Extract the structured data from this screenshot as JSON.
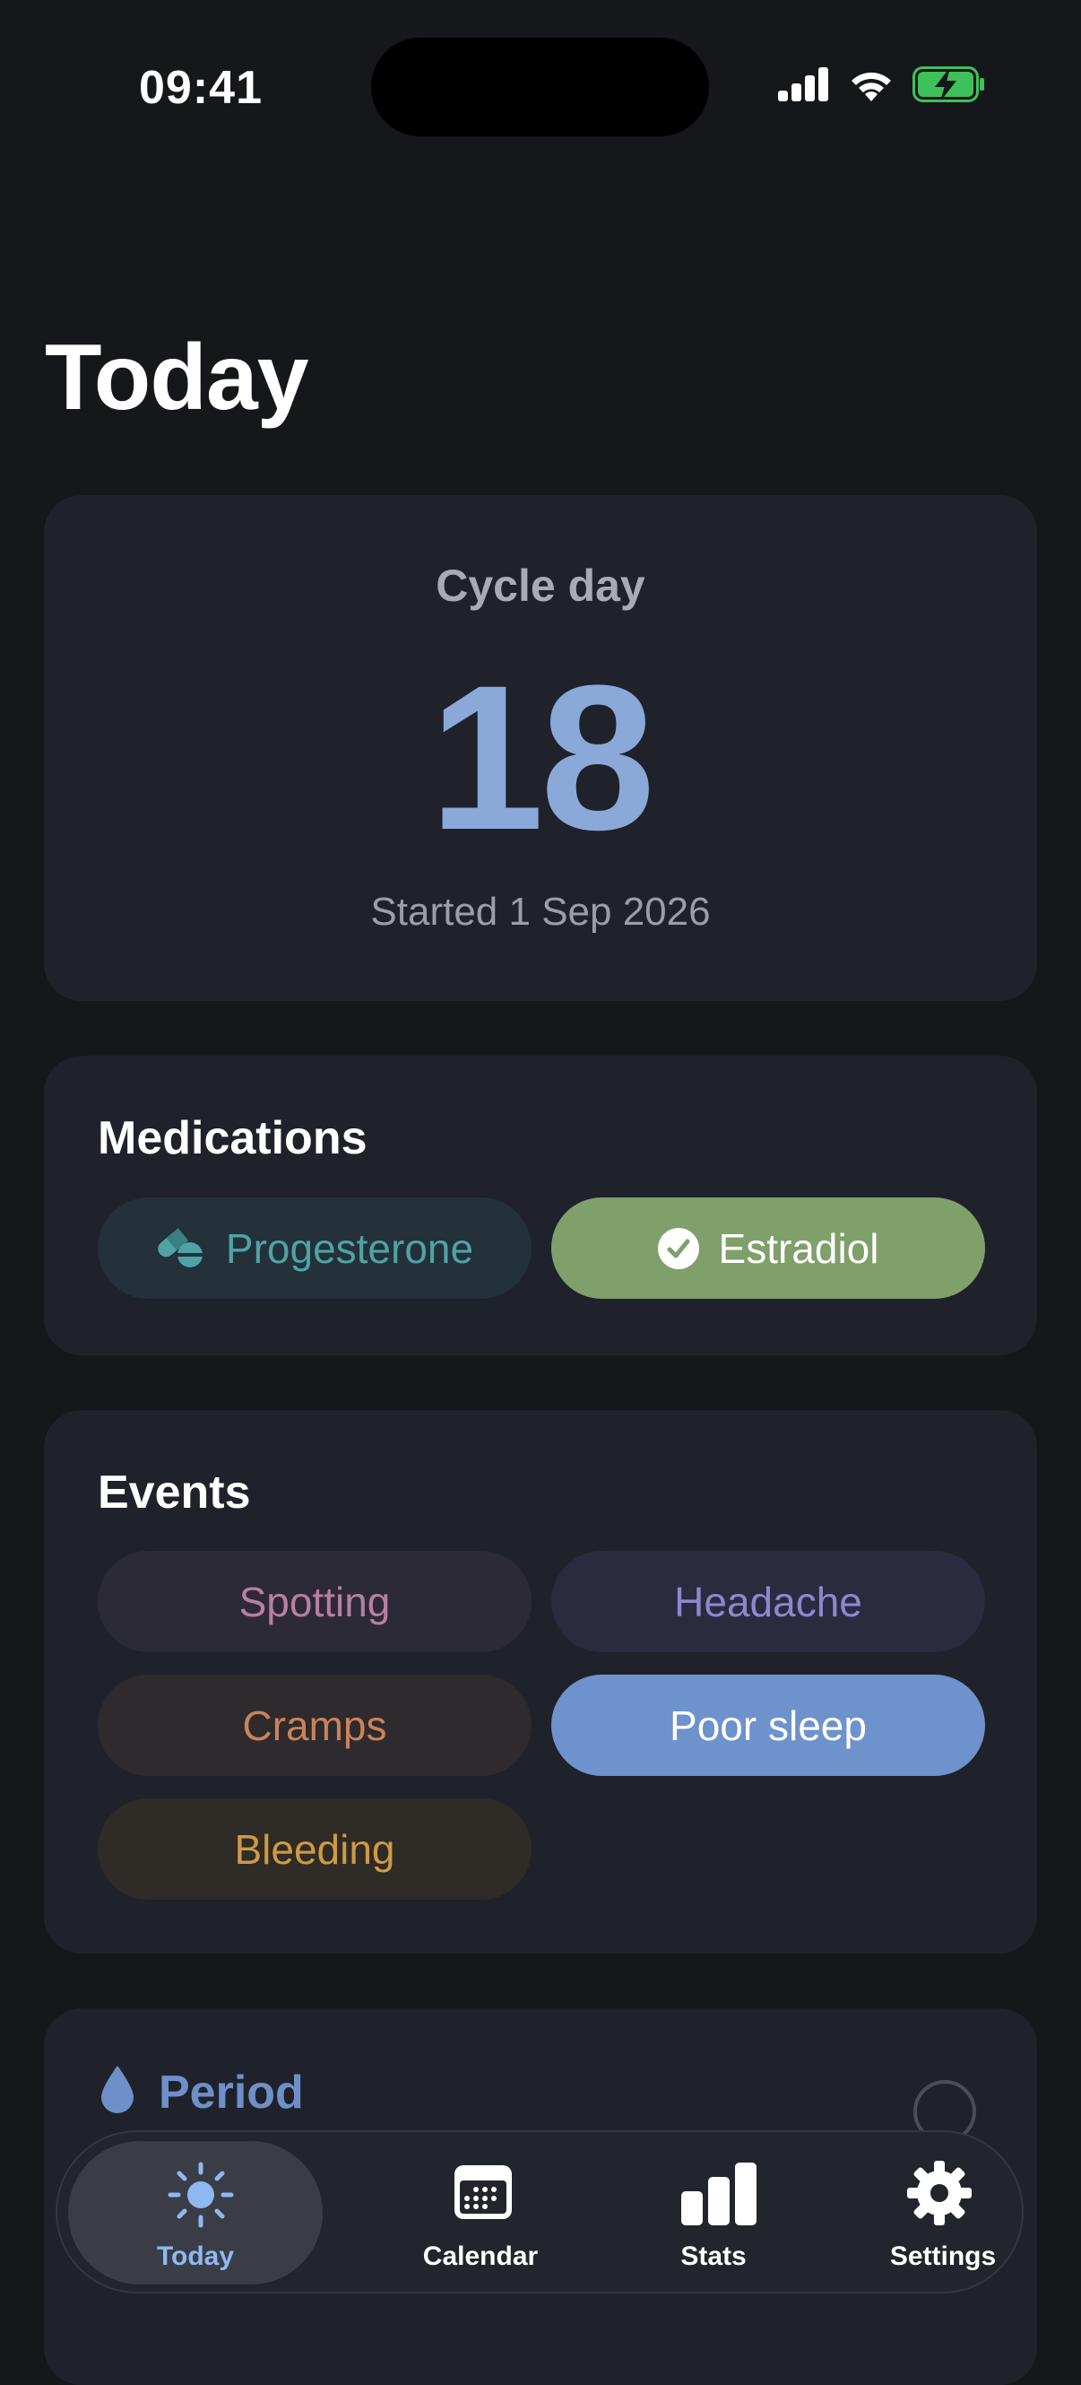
{
  "status_bar": {
    "time": "09:41"
  },
  "page": {
    "title": "Today"
  },
  "cycle": {
    "label": "Cycle day",
    "day": "18",
    "started": "Started 1 Sep 2026"
  },
  "medications": {
    "title": "Medications",
    "items": [
      {
        "label": "Progesterone",
        "icon": "pill-icon",
        "taken": false,
        "color": "#4fa3a5",
        "bg": "#24303a"
      },
      {
        "label": "Estradiol",
        "icon": "check-circle-icon",
        "taken": true,
        "color": "#ffffff",
        "bg": "#7fa06a"
      }
    ]
  },
  "events": {
    "title": "Events",
    "items": [
      {
        "label": "Spotting",
        "selected": false,
        "color": "#b87fa0",
        "bg": "#2c2a36"
      },
      {
        "label": "Headache",
        "selected": false,
        "color": "#8f86d0",
        "bg": "#2a2b3e"
      },
      {
        "label": "Cramps",
        "selected": false,
        "color": "#c9835a",
        "bg": "#2e2a2e"
      },
      {
        "label": "Poor sleep",
        "selected": true,
        "color": "#ffffff",
        "bg": "#6e92cc"
      },
      {
        "label": "Bleeding",
        "selected": false,
        "color": "#cf9a45",
        "bg": "#2f2b27"
      }
    ]
  },
  "period": {
    "title": "Period",
    "icon": "drop-icon",
    "color": "#6f8fc8"
  },
  "tab_bar": {
    "tabs": [
      {
        "label": "Today",
        "icon": "sun-icon",
        "active": true
      },
      {
        "label": "Calendar",
        "icon": "calendar-icon",
        "active": false
      },
      {
        "label": "Stats",
        "icon": "bar-chart-icon",
        "active": false
      },
      {
        "label": "Settings",
        "icon": "gear-icon",
        "active": false
      }
    ]
  },
  "colors": {
    "background": "#16171b",
    "card": "#1f222a",
    "accent": "#8aa9d8"
  }
}
